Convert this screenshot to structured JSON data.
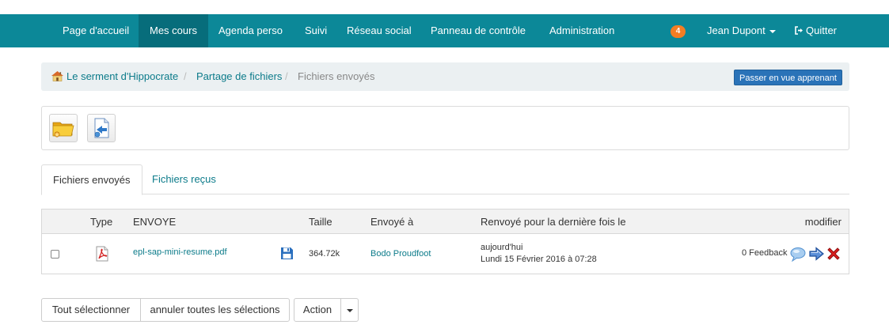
{
  "nav": {
    "items": [
      {
        "label": "Page d'accueil"
      },
      {
        "label": "Mes cours"
      },
      {
        "label": "Agenda perso"
      },
      {
        "label": "Suivi"
      },
      {
        "label": "Réseau social"
      },
      {
        "label": "Panneau de contrôle"
      },
      {
        "label": "Administration"
      }
    ],
    "active_item": "Mes cours",
    "notification_count": "4",
    "user_name": "Jean Dupont",
    "logout_label": "Quitter"
  },
  "breadcrumb": {
    "course": "Le serment d'Hippocrate",
    "section": "Partage de fichiers",
    "current": "Fichiers envoyés",
    "separator": "/"
  },
  "learner_view_button": "Passer en vue apprenant",
  "toolbar": {
    "icons": [
      "folder-upload-icon",
      "send-file-icon"
    ]
  },
  "tabs": [
    {
      "label": "Fichiers envoyés",
      "active": true
    },
    {
      "label": "Fichiers reçus",
      "active": false
    }
  ],
  "table": {
    "headers": {
      "type": "Type",
      "name": "ENVOYE",
      "size": "Taille",
      "sent_to": "Envoyé à",
      "resent": "Renvoyé pour la dernière fois le",
      "modify": "modifier"
    },
    "rows": [
      {
        "file_icon": "pdf-icon",
        "name": "epl-sap-mini-resume.pdf",
        "size": "364.72k",
        "sent_to": "Bodo Proudfoot",
        "resent_relative": "aujourd'hui",
        "resent_date": "Lundi 15 Février 2016 à 07:28",
        "feedback": "0 Feedback"
      }
    ]
  },
  "actions": {
    "select_all": "Tout sélectionner",
    "unselect_all": "annuler toutes les sélections",
    "action": "Action"
  },
  "colors": {
    "navbar": "#0c8898",
    "navbar_active": "#076d7b",
    "link": "#0c7b8a",
    "badge": "#f47d23",
    "primary_button": "#2a73b8"
  }
}
